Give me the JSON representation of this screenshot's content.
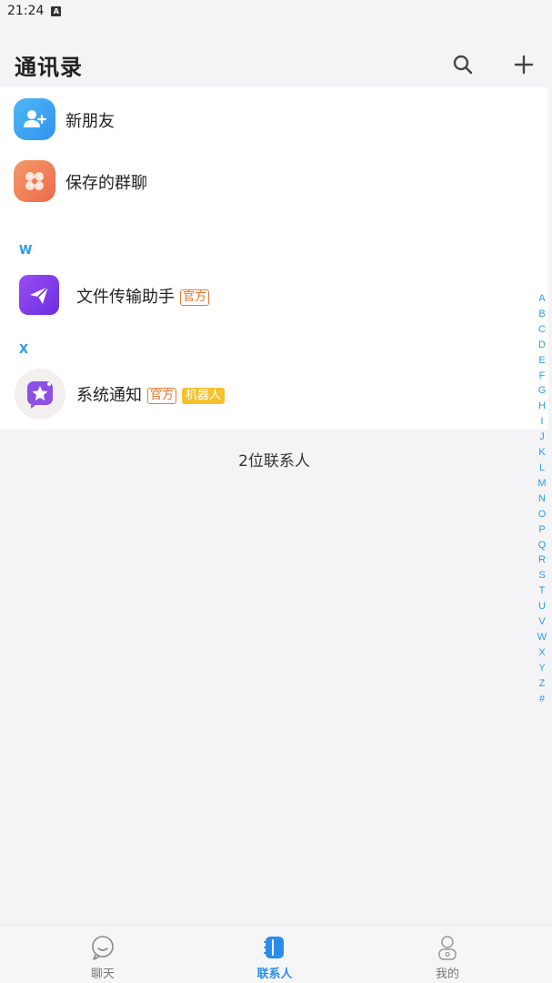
{
  "status_bar": {
    "time": "21:24",
    "notification_badge": "A"
  },
  "header": {
    "title": "通讯录",
    "search_icon": "search-icon",
    "add_icon": "plus-icon"
  },
  "top_items": [
    {
      "label": "新朋友",
      "icon": "add-friend-icon",
      "color": "#3aa6f2"
    },
    {
      "label": "保存的群聊",
      "icon": "group-chat-icon",
      "color": "#f07a4e"
    }
  ],
  "sections": [
    {
      "letter": "W",
      "contacts": [
        {
          "name": "文件传输助手",
          "tags": [
            "官方"
          ],
          "icon": "paper-plane-icon",
          "color": "#7a3df0"
        }
      ]
    },
    {
      "letter": "X",
      "contacts": [
        {
          "name": "系统通知",
          "tags": [
            "官方",
            "机器人"
          ],
          "icon": "star-message-icon",
          "color": "#8c4fe8"
        }
      ]
    }
  ],
  "contact_count": "2位联系人",
  "alpha_index": [
    "A",
    "B",
    "C",
    "D",
    "E",
    "F",
    "G",
    "H",
    "I",
    "J",
    "K",
    "L",
    "M",
    "N",
    "O",
    "P",
    "Q",
    "R",
    "S",
    "T",
    "U",
    "V",
    "W",
    "X",
    "Y",
    "Z",
    "#"
  ],
  "tabs": [
    {
      "label": "聊天",
      "icon": "chat-bubble-icon",
      "active": false
    },
    {
      "label": "联系人",
      "icon": "contacts-book-icon",
      "active": true
    },
    {
      "label": "我的",
      "icon": "profile-icon",
      "active": false
    }
  ],
  "colors": {
    "accent": "#2a8ee8",
    "index_blue": "#2a9be8",
    "official_orange": "#e8742a",
    "robot_yellow": "#f4c22b"
  }
}
